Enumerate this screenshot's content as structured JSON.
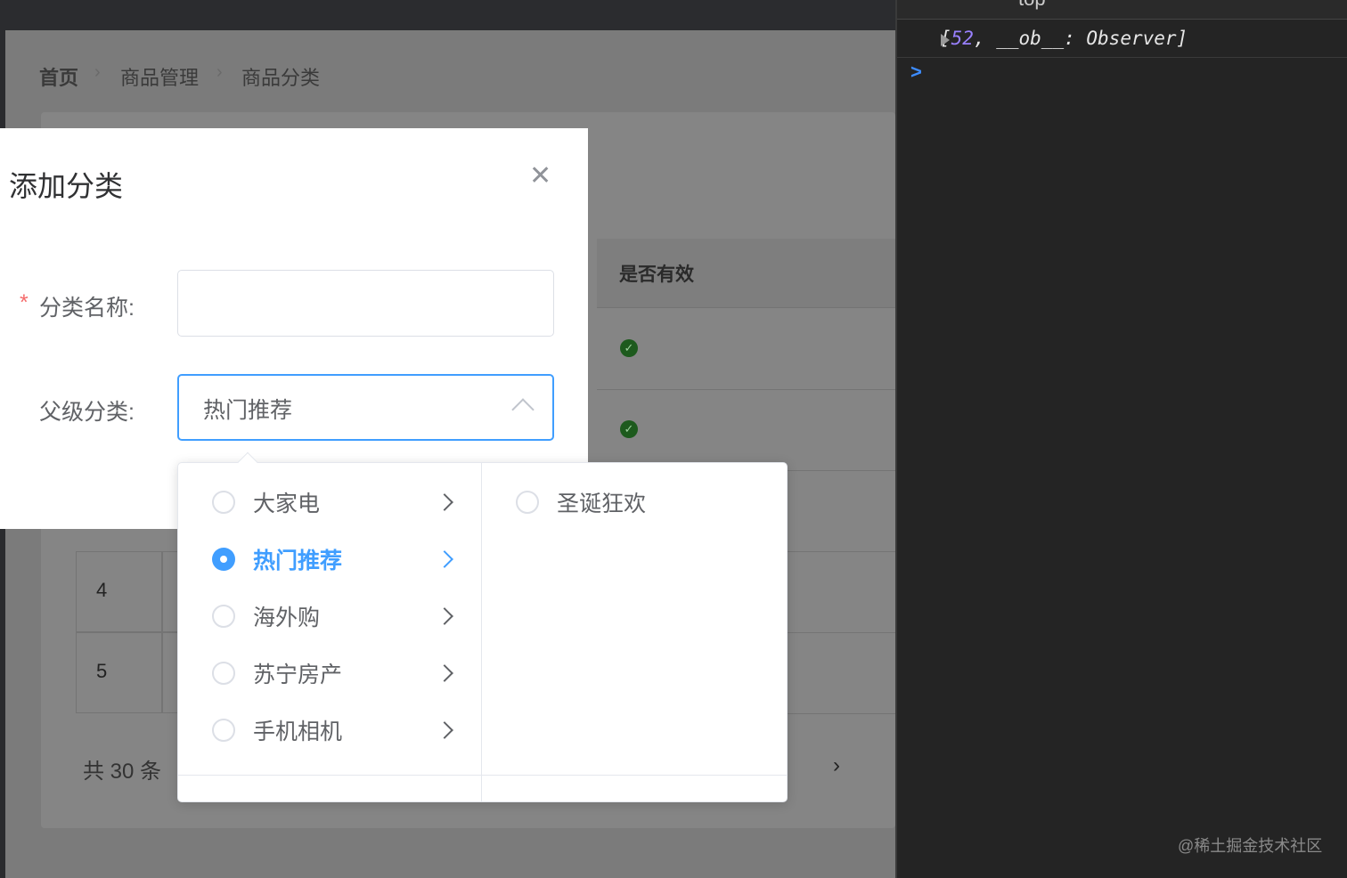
{
  "breadcrumb": [
    "首页",
    "商品管理",
    "商品分类"
  ],
  "table": {
    "header_valid": "是否有效",
    "rows": [
      "4",
      "5"
    ],
    "total": "共 30 条"
  },
  "dialog": {
    "title": "添加分类",
    "name_label": "分类名称:",
    "name_value": "",
    "parent_label": "父级分类:",
    "parent_value": "热门推荐"
  },
  "cascader": {
    "level1": [
      {
        "label": "大家电",
        "checked": false
      },
      {
        "label": "热门推荐",
        "checked": true
      },
      {
        "label": "海外购",
        "checked": false
      },
      {
        "label": "苏宁房产",
        "checked": false
      },
      {
        "label": "手机相机",
        "checked": false
      }
    ],
    "level2": [
      {
        "label": "圣诞狂欢",
        "checked": false
      }
    ]
  },
  "devtools": {
    "context": "top",
    "log_prefix": "[",
    "log_num": "52",
    "log_rest": ", __ob__: Observer]",
    "prompt": ">"
  },
  "watermark": "@稀土掘金技术社区",
  "colors": {
    "primary": "#409eff",
    "danger": "#f56c6c"
  }
}
